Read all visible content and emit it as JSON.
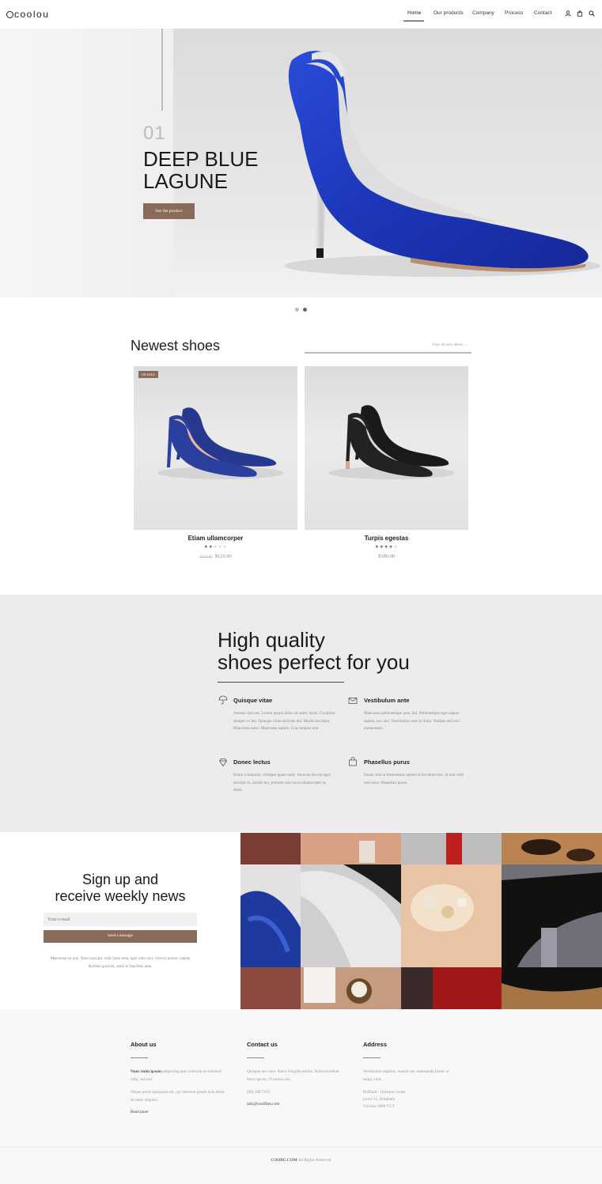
{
  "header": {
    "logo": "coolou",
    "nav": [
      "Home",
      "Our products",
      "Company",
      "Process",
      "Contact"
    ],
    "active_nav": "Home",
    "icons": [
      "user-icon",
      "cart-icon",
      "search-icon"
    ]
  },
  "hero": {
    "number": "01",
    "title_line1": "DEEP BLUE",
    "title_line2": "LAGUNE",
    "button": "See the product",
    "slides": 2,
    "active_slide": 2
  },
  "newest": {
    "title": "Newest shoes",
    "view_all": "View all new shoes →",
    "products": [
      {
        "name": "Etiam ullamcorper",
        "badge": "ON SALE",
        "rating": 2,
        "rating_max": 5,
        "old_price": "$150,00",
        "price": "$125,00"
      },
      {
        "name": "Turpis egestas",
        "badge": "",
        "rating": 4,
        "rating_max": 5,
        "old_price": "",
        "price": "$380,00"
      }
    ]
  },
  "quality": {
    "title_line1": "High quality",
    "title_line2": "shoes perfect for you",
    "features": [
      {
        "icon": "umbrella-icon",
        "title": "Quisque vitae",
        "text": "Aenean quis est. Lorem ipsum dolor sit amet, lacus. Curabitur semper ex leo. Quisque vitae ultricies dui. Morbi tincidunt. Maecenas nunc. Maecenas sapien. Cras tempus erat."
      },
      {
        "icon": "envelope-icon",
        "title": "Vestibulum ante",
        "text": "Maecenas pellentesque quis, dui. Pellentesque eget sapien sapien, nec nisl. Vestibulum ante in dolor. Nullam sed orci elementum."
      },
      {
        "icon": "diamond-icon",
        "title": "Donec lectus",
        "text": "Etiam commodo, volutpat quam nunc, rhoncus dui est eget, suscipit in, iaculis leo, pretium non lacus ullamcorper ut, dolor."
      },
      {
        "icon": "bag-icon",
        "title": "Phasellus purus",
        "text": "Donec nisl at fermentum sapien id tincidunt nisi, id erat velit non nunc. Phasellus purus."
      }
    ]
  },
  "newsletter": {
    "title_line1": "Sign up and",
    "title_line2": "receive weekly news",
    "placeholder": "Your e-mail",
    "button": "Send a message",
    "text": "Maecenas eu nisl. Nam suscipit, velit justo mea, eget odio orci, viverra auctor, sapien facilisis gravida, amet in faucibus ante."
  },
  "footer": {
    "about": {
      "title": "About us",
      "text1_bold": "Nunc enim ipsum",
      "text1": "adipiscing quis vehicula ut euismod velit, sed nisi.",
      "text2": "Neque porro quisquam est, qui dolorem ipsum quia dolor sit amet adipisci.",
      "link": "Read more"
    },
    "contact": {
      "title": "Contact us",
      "text": "Quisque nec nunc libero fringilla mollis. Nulla tincidunt fusce ipsum. Vivamus nisi.",
      "phone": "(00) 208 7291",
      "email": "info@coolfiles.com"
    },
    "address": {
      "title": "Address",
      "text": "Vestibulum dapibus, mauris nec malesuada fames ac turpis velit.",
      "line1": "Brilliant - Quisque cursus",
      "line2": "Level 15, Elisabeth",
      "line3": "Victoria 3000 VCT"
    },
    "copyright_bold": "COOBU.COM",
    "copyright": "All Rights Reserved"
  },
  "colors": {
    "accent": "#8a6a58",
    "shoe_blue": "#1f3fbf",
    "quality_bg": "#ececed",
    "star_on": "#7a6a62",
    "star_off": "#d8d8d8"
  }
}
